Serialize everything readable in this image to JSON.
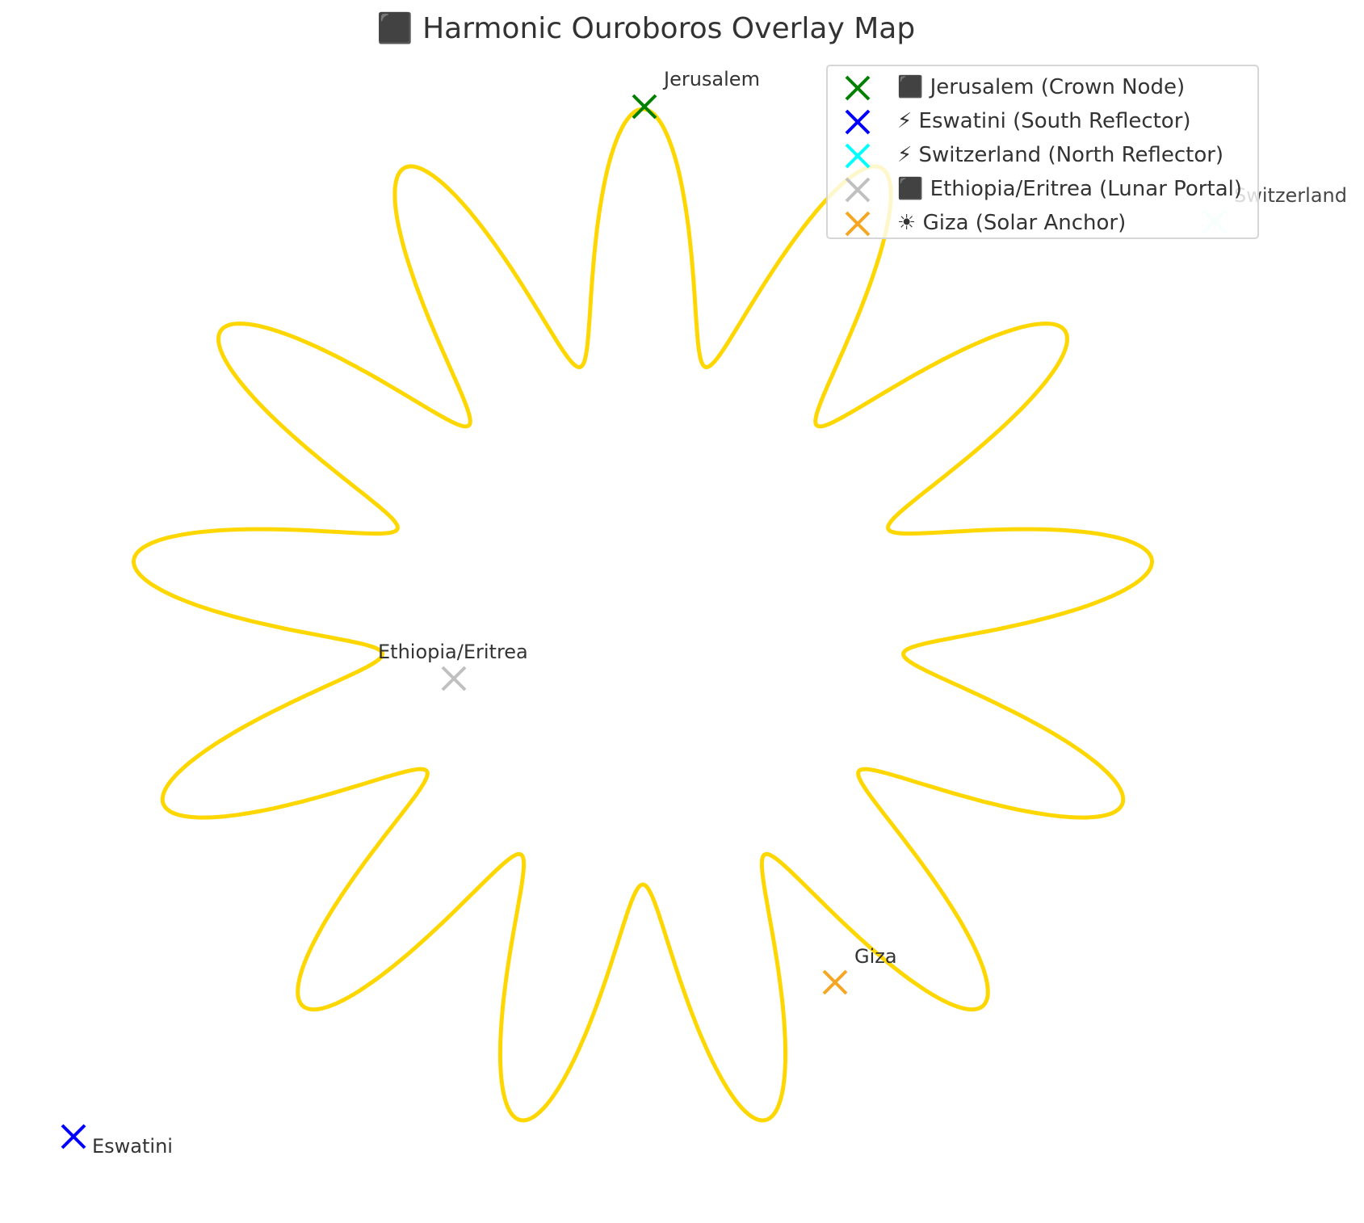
{
  "chart_data": {
    "type": "line",
    "title": "⬛ Harmonic Ouroboros Overlay Map",
    "grid": false,
    "axes_visible": false,
    "legend_placement": "top-right",
    "curve": {
      "shape": "polar rose",
      "color": "#FFD700",
      "lobes": 13
    },
    "points": [
      {
        "name": "Jerusalem",
        "legend": "⬛ Jerusalem (Crown Node)",
        "color": "#008000"
      },
      {
        "name": "Eswatini",
        "legend": "⚡ Eswatini (South Reflector)",
        "color": "#0000FF"
      },
      {
        "name": "Switzerland",
        "legend": "⚡ Switzerland (North Reflector)",
        "color": "#00FFFF"
      },
      {
        "name": "Ethiopia/Eritrea",
        "legend": "⬛ Ethiopia/Eritrea (Lunar Portal)",
        "color": "#C0C0C0"
      },
      {
        "name": "Giza",
        "legend": "☀ Giza (Solar Anchor)",
        "color": "#F5A623"
      }
    ]
  }
}
